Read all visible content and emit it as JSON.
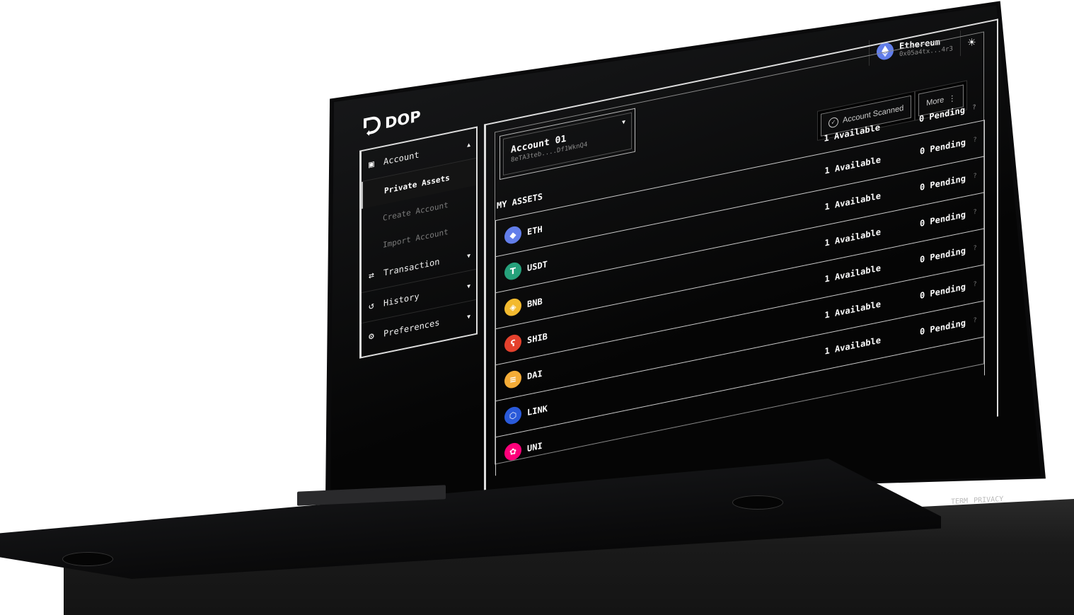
{
  "brand": {
    "name": "DOP"
  },
  "network": {
    "name": "Ethereum",
    "address": "0x05a4tx...4r3",
    "icon": "ethereum-icon"
  },
  "toolbar": {
    "account_scanned_label": "Account Scanned",
    "more_label": "More"
  },
  "sidebar": {
    "account": {
      "label": "Account",
      "items": [
        {
          "label": "Private Assets",
          "active": true
        },
        {
          "label": "Create Account"
        },
        {
          "label": "Import Account"
        }
      ]
    },
    "transaction": {
      "label": "Transaction"
    },
    "history": {
      "label": "History"
    },
    "preferences": {
      "label": "Preferences"
    }
  },
  "account_selector": {
    "name": "Account 01",
    "address": "8eTA3teb....Df1WknQ4"
  },
  "assets": {
    "title": "MY ASSETS",
    "summary": {
      "available": "1 Available",
      "pending": "0 Pending"
    },
    "rows": [
      {
        "symbol": "ETH",
        "available": "1 Available",
        "pending": "0 Pending",
        "color": "#627eea"
      },
      {
        "symbol": "USDT",
        "available": "1 Available",
        "pending": "0 Pending",
        "color": "#26a17b"
      },
      {
        "symbol": "BNB",
        "available": "1 Available",
        "pending": "0 Pending",
        "color": "#f3ba2f"
      },
      {
        "symbol": "SHIB",
        "available": "1 Available",
        "pending": "0 Pending",
        "color": "#e4412d"
      },
      {
        "symbol": "DAI",
        "available": "1 Available",
        "pending": "0 Pending",
        "color": "#f5ac37"
      },
      {
        "symbol": "LINK",
        "available": "1 Available",
        "pending": "0 Pending",
        "color": "#2a5ada"
      },
      {
        "symbol": "UNI",
        "available": "",
        "pending": "",
        "color": "#ff007a"
      }
    ]
  },
  "footer": {
    "term": "TERM",
    "privacy": "PRIVACY"
  }
}
